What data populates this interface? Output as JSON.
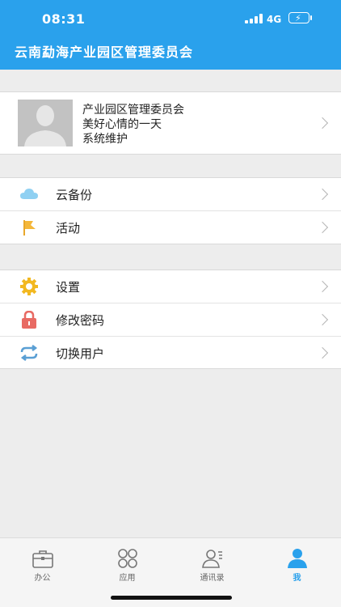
{
  "status_bar": {
    "time": "08:31",
    "network": "4G"
  },
  "header": {
    "title": "云南勐海产业园区管理委员会"
  },
  "profile": {
    "name": "产业园区管理委员会",
    "mood": "美好心情的一天",
    "role": "系统维护"
  },
  "menu_group_1": [
    {
      "label": "云备份",
      "icon": "cloud-icon"
    },
    {
      "label": "活动",
      "icon": "flag-icon"
    }
  ],
  "menu_group_2": [
    {
      "label": "设置",
      "icon": "gear-icon"
    },
    {
      "label": "修改密码",
      "icon": "lock-icon"
    },
    {
      "label": "切换用户",
      "icon": "switch-icon"
    }
  ],
  "tabs": [
    {
      "label": "办公",
      "icon": "briefcase-icon",
      "active": false
    },
    {
      "label": "应用",
      "icon": "apps-grid-icon",
      "active": false
    },
    {
      "label": "通讯录",
      "icon": "contacts-icon",
      "active": false
    },
    {
      "label": "我",
      "icon": "person-icon",
      "active": true
    }
  ],
  "colors": {
    "accent": "#2aa1ec",
    "background": "#ededed"
  }
}
